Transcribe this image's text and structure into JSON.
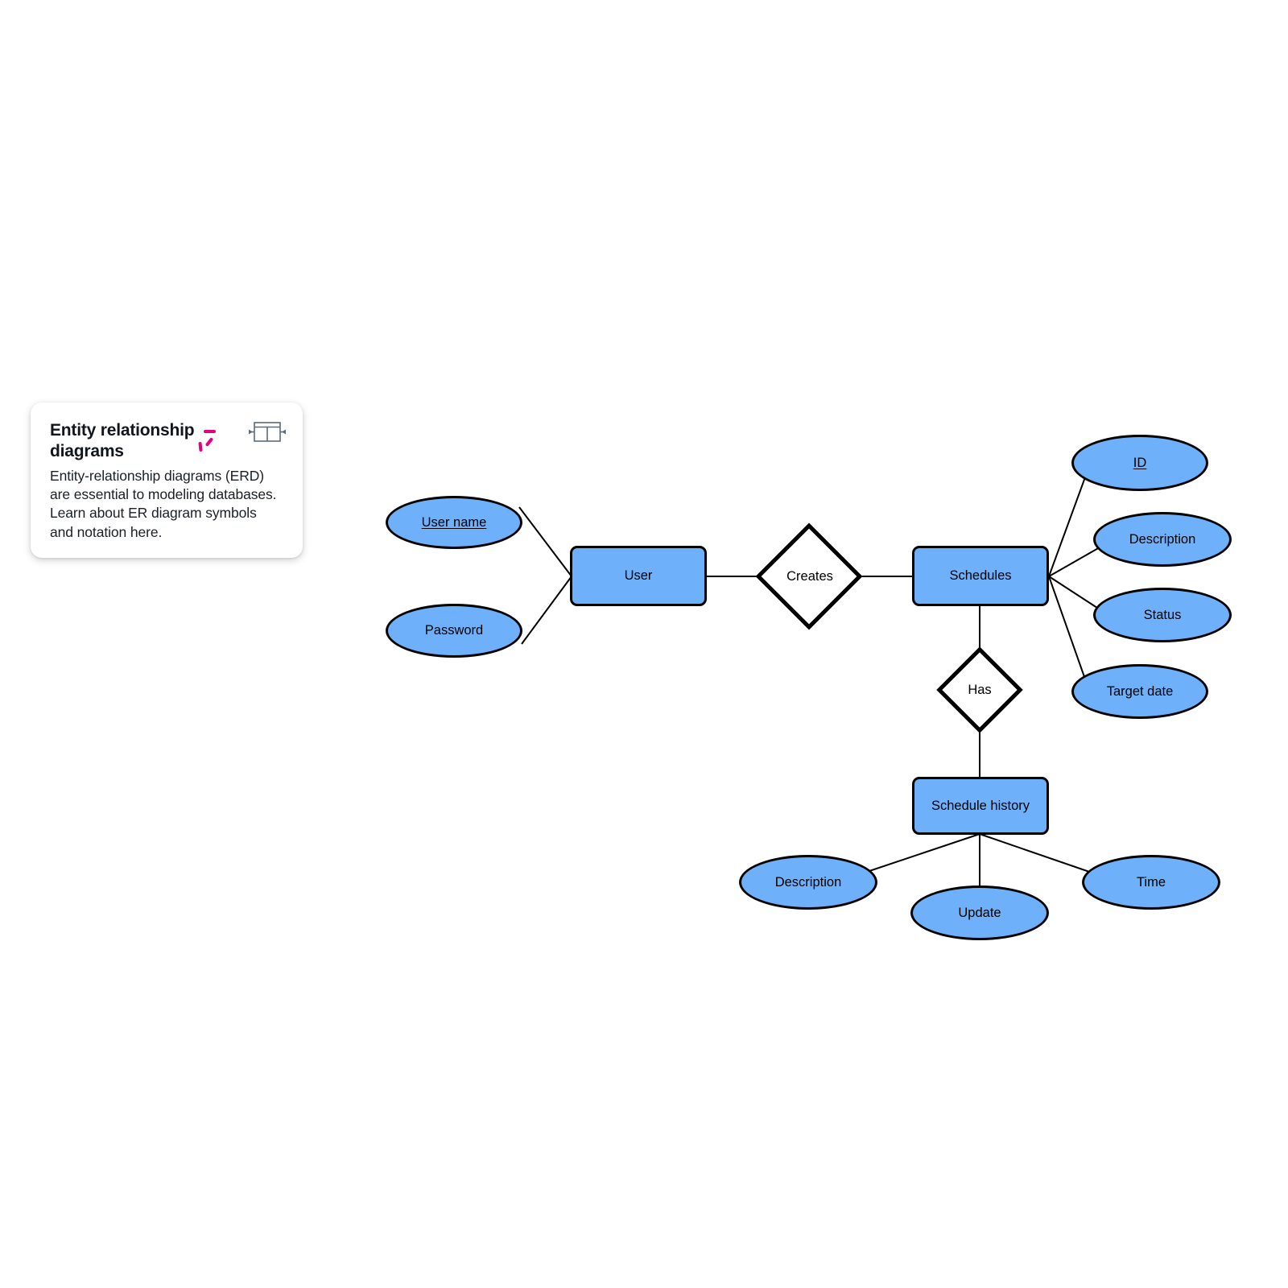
{
  "card": {
    "title": "Entity relationship diagrams",
    "body": "Entity-relationship diagrams (ERD) are essential to modeling databases. Learn about ER diagram symbols and notation here.",
    "icon": "table-icon",
    "accent_color": "#e6007e"
  },
  "colors": {
    "entity_fill": "#6EB1FA",
    "attribute_fill": "#6EB1FA",
    "relationship_fill": "#ffffff",
    "stroke": "#000000",
    "background": "#ffffff"
  },
  "chart_data": {
    "type": "diagram",
    "diagram_type": "entity-relationship-diagram",
    "title": "Entity relationship diagrams",
    "entities": [
      {
        "id": "user",
        "label": "User"
      },
      {
        "id": "schedules",
        "label": "Schedules"
      },
      {
        "id": "schedule_history",
        "label": "Schedule history"
      }
    ],
    "relationships": [
      {
        "id": "creates",
        "label": "Creates",
        "from": "user",
        "to": "schedules"
      },
      {
        "id": "has",
        "label": "Has",
        "from": "schedules",
        "to": "schedule_history"
      }
    ],
    "attributes": [
      {
        "id": "user_name",
        "label": "User name",
        "entity": "user",
        "key": true
      },
      {
        "id": "password",
        "label": "Password",
        "entity": "user",
        "key": false
      },
      {
        "id": "sched_id",
        "label": "ID",
        "entity": "schedules",
        "key": true
      },
      {
        "id": "sched_description",
        "label": "Description",
        "entity": "schedules",
        "key": false
      },
      {
        "id": "sched_status",
        "label": "Status",
        "entity": "schedules",
        "key": false
      },
      {
        "id": "sched_target_date",
        "label": "Target date",
        "entity": "schedules",
        "key": false
      },
      {
        "id": "hist_description",
        "label": "Description",
        "entity": "schedule_history",
        "key": false
      },
      {
        "id": "hist_update",
        "label": "Update",
        "entity": "schedule_history",
        "key": false
      },
      {
        "id": "hist_time",
        "label": "Time",
        "entity": "schedule_history",
        "key": false
      }
    ]
  },
  "nodes": {
    "user_name": "User name",
    "password": "Password",
    "user": "User",
    "creates": "Creates",
    "schedules": "Schedules",
    "sched_id": "ID",
    "sched_description": "Description",
    "sched_status": "Status",
    "sched_target_date": "Target date",
    "has": "Has",
    "schedule_history": "Schedule history",
    "hist_description": "Description",
    "hist_update": "Update",
    "hist_time": "Time"
  }
}
